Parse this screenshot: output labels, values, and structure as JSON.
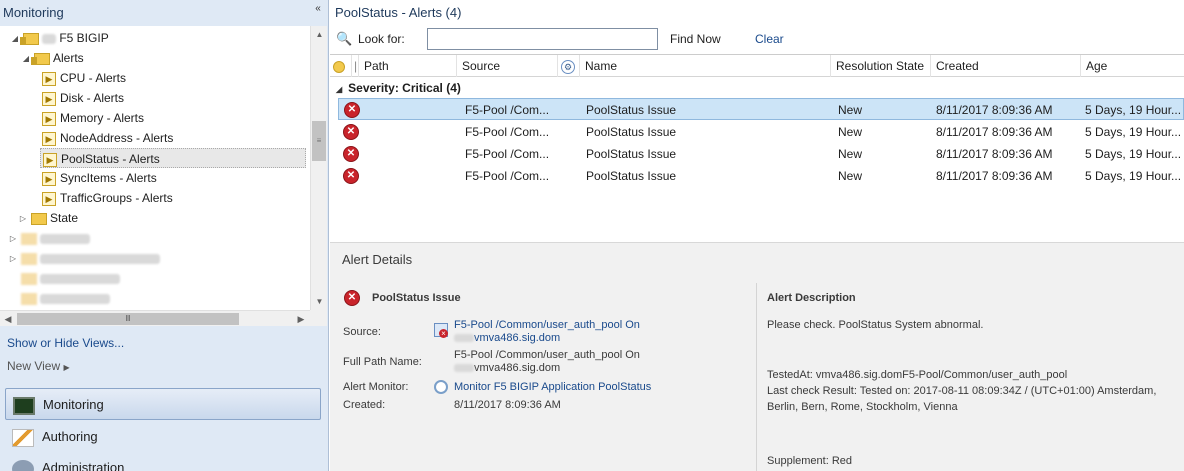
{
  "nav": {
    "header": "Monitoring",
    "collapse_glyph": "«",
    "tree": [
      {
        "label": "F5 BIGIP",
        "blurred_prefix": true
      },
      {
        "label": "Alerts"
      },
      {
        "label": "CPU - Alerts"
      },
      {
        "label": "Disk - Alerts"
      },
      {
        "label": "Memory - Alerts"
      },
      {
        "label": "NodeAddress - Alerts"
      },
      {
        "label": "PoolStatus - Alerts"
      },
      {
        "label": "SyncItems - Alerts"
      },
      {
        "label": "TrafficGroups - Alerts"
      },
      {
        "label": "State"
      }
    ],
    "show_hide_views": "Show or Hide Views...",
    "new_view": "New View",
    "wunderbar": [
      {
        "label": "Monitoring",
        "icon": "monitoring-icon"
      },
      {
        "label": "Authoring",
        "icon": "authoring-icon"
      },
      {
        "label": "Administration",
        "icon": "administration-icon"
      }
    ]
  },
  "main": {
    "title": "PoolStatus - Alerts (4)",
    "search": {
      "label": "Look for:",
      "value": "",
      "find_now": "Find Now",
      "clear": "Clear"
    },
    "columns": [
      "Path",
      "Source",
      "Name",
      "Resolution State",
      "Created",
      "Age"
    ],
    "group_label": "Severity: Critical (4)",
    "rows": [
      {
        "source": "F5-Pool /Com...",
        "name": "PoolStatus Issue",
        "resolution": "New",
        "created": "8/11/2017 8:09:36 AM",
        "age": "5 Days, 19 Hour..."
      },
      {
        "source": "F5-Pool /Com...",
        "name": "PoolStatus Issue",
        "resolution": "New",
        "created": "8/11/2017 8:09:36 AM",
        "age": "5 Days, 19 Hour..."
      },
      {
        "source": "F5-Pool /Com...",
        "name": "PoolStatus Issue",
        "resolution": "New",
        "created": "8/11/2017 8:09:36 AM",
        "age": "5 Days, 19 Hour..."
      },
      {
        "source": "F5-Pool /Com...",
        "name": "PoolStatus Issue",
        "resolution": "New",
        "created": "8/11/2017 8:09:36 AM",
        "age": "5 Days, 19 Hour..."
      }
    ]
  },
  "details": {
    "title": "Alert Details",
    "alert_name": "PoolStatus Issue",
    "source_label": "Source:",
    "source_line1": "F5-Pool /Common/user_auth_pool On",
    "source_line2": "vmva486.sig.dom",
    "full_path_label": "Full Path Name:",
    "full_path_line1": "F5-Pool /Common/user_auth_pool On",
    "full_path_line2": "vmva486.sig.dom",
    "monitor_label": "Alert Monitor:",
    "monitor_value": "Monitor F5 BIGIP Application PoolStatus",
    "created_label": "Created:",
    "created_value": "8/11/2017 8:09:36 AM",
    "desc_header": "Alert Description",
    "desc_line1": "Please check. PoolStatus System abnormal.",
    "desc_tested": "TestedAt: vmva486.sig.domF5-Pool/Common/user_auth_pool",
    "desc_last_check": "Last check Result: Tested on: 2017-08-11 08:09:34Z / (UTC+01:00) Amsterdam, Berlin, Bern, Rome, Stockholm, Vienna",
    "desc_supplement": "Supplement: Red"
  },
  "colors": {
    "accent": "#1a4a8c",
    "critical": "#c9242b",
    "selection": "#cce4f7"
  }
}
